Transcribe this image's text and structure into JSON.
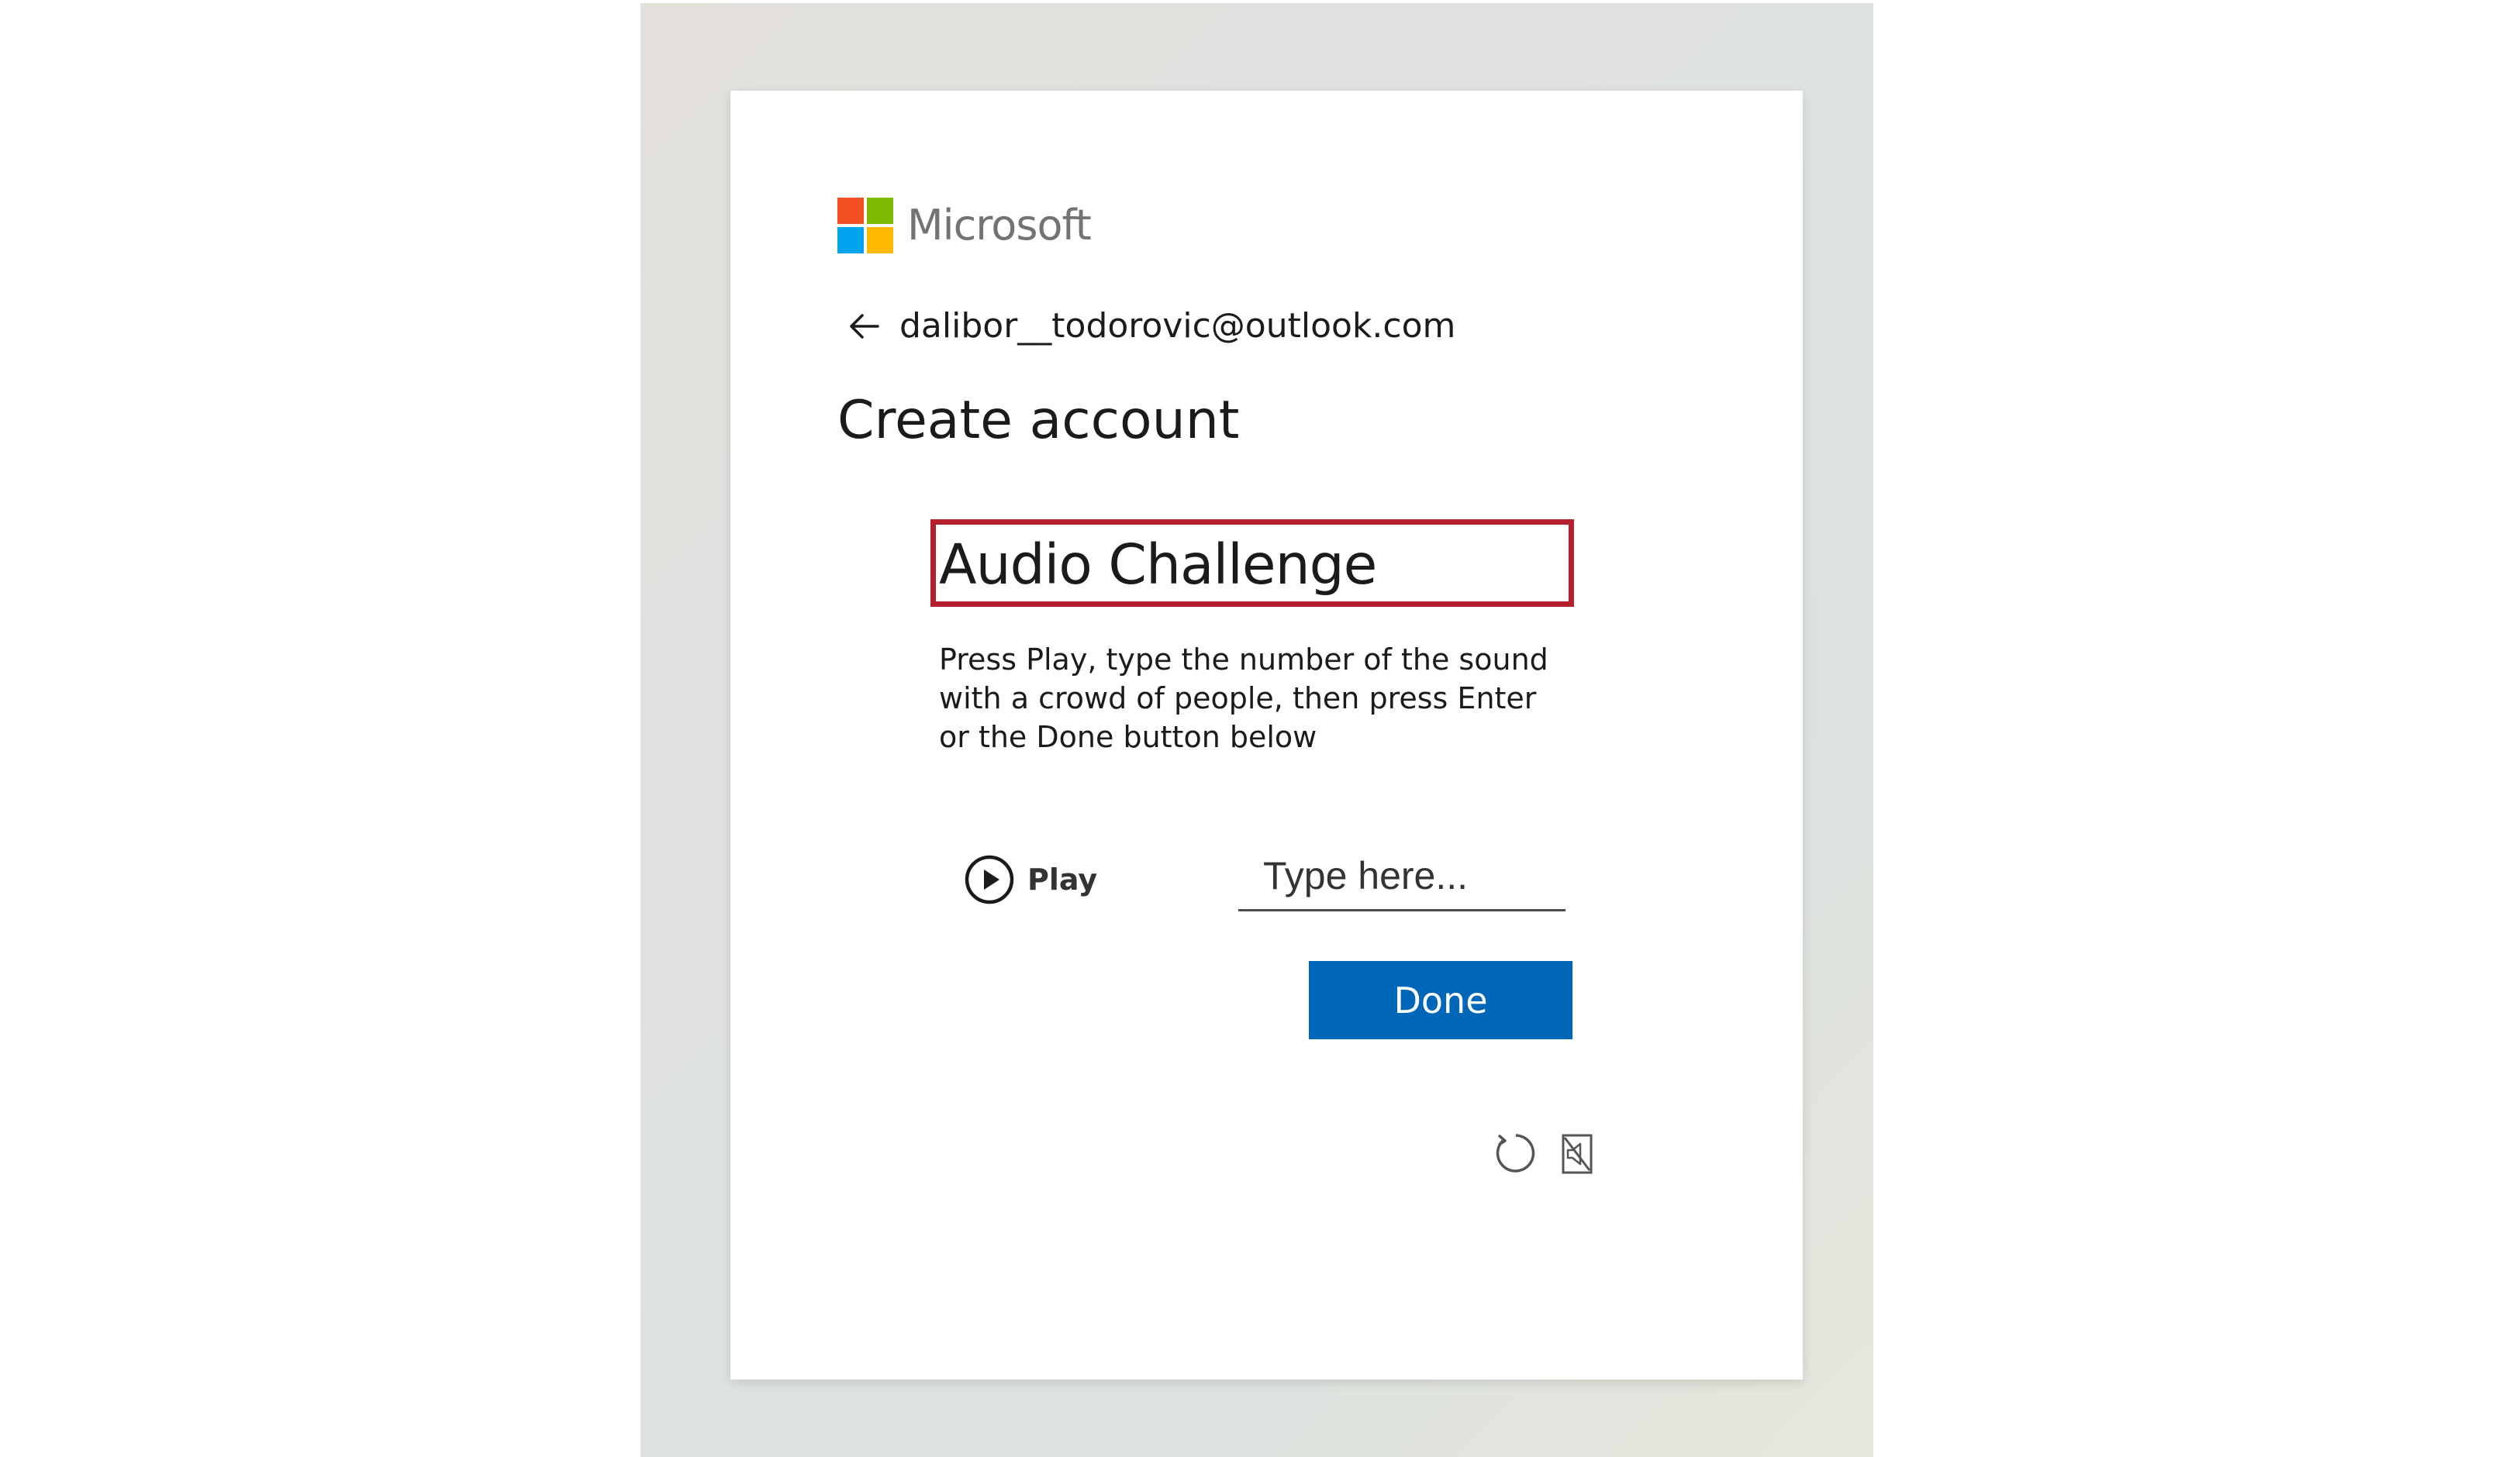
{
  "brand": {
    "name": "Microsoft",
    "logo_colors": [
      "#f25022",
      "#7fba00",
      "#00a4ef",
      "#ffb900"
    ]
  },
  "header": {
    "back_icon": "back-arrow-icon",
    "email": "dalibor__todorovic@outlook.com",
    "title": "Create account"
  },
  "challenge": {
    "title": "Audio Challenge",
    "highlight_color": "#b5202e",
    "instructions": "Press Play, type the number of the sound with a crowd of people, then press Enter or the Done button below",
    "play_label": "Play",
    "play_icon": "play-circle-icon",
    "input_placeholder": "Type here...",
    "input_value": "",
    "done_label": "Done",
    "done_color": "#0067b8",
    "refresh_icon": "refresh-icon",
    "audio_toggle_icon": "audio-off-icon"
  }
}
